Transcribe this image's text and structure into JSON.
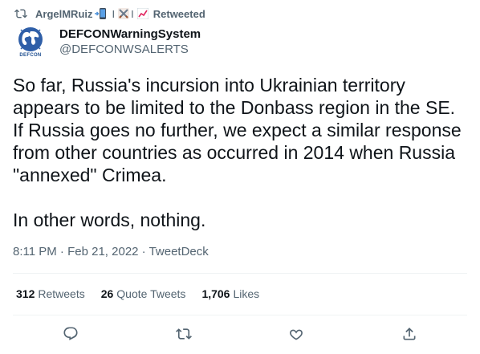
{
  "retweet_context": {
    "user": "ArgelMRuiz",
    "emoji": [
      "mobile-phone-arrow-icon",
      "crossed-swords-icon",
      "chart-increasing-icon"
    ],
    "separator": "I",
    "label": "Retweeted"
  },
  "author": {
    "avatar_label": "DEFCON",
    "display_name": "DEFCONWarningSystem",
    "handle": "@DEFCONWSALERTS"
  },
  "tweet": {
    "text": "So far, Russia's incursion into Ukrainian territory appears to be limited to the Donbass region in the SE. If Russia goes no further, we expect a similar response from other countries as occurred in 2014 when Russia \"annexed\" Crimea.\n\nIn other words, nothing.",
    "time": "8:11 PM",
    "date": "Feb 21, 2022",
    "source": "TweetDeck",
    "dot": "·"
  },
  "stats": {
    "retweets_count": "312",
    "retweets_label": "Retweets",
    "quotes_count": "26",
    "quotes_label": "Quote Tweets",
    "likes_count": "1,706",
    "likes_label": "Likes"
  },
  "colors": {
    "text_primary": "#0f1419",
    "text_secondary": "#536471",
    "divider": "#eff3f4"
  }
}
